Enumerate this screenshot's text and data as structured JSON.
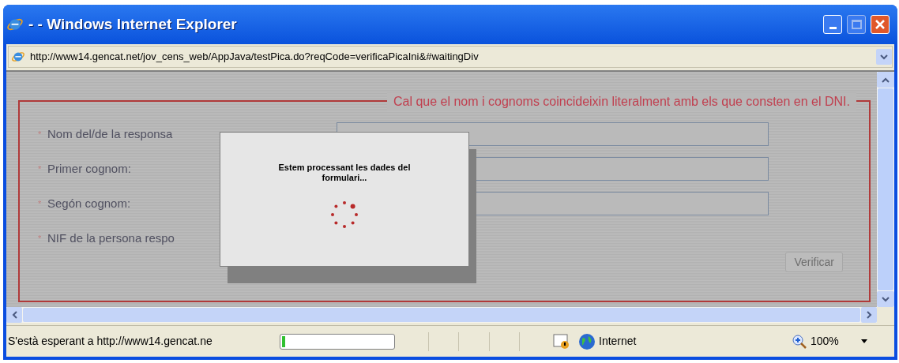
{
  "window": {
    "title": "- - Windows Internet Explorer"
  },
  "address_bar": {
    "url": "http://www14.gencat.net/jov_cens_web/AppJava/testPica.do?reqCode=verificaPicaIni&#waitingDiv"
  },
  "form": {
    "legend": "Cal que el nom i cognoms coincideixin literalment amb els que consten en el DNI.",
    "fields": [
      {
        "marker": "*",
        "label": "Nom del/de la responsa",
        "kind": "text"
      },
      {
        "marker": "*",
        "label": "Primer cognom:",
        "kind": "text"
      },
      {
        "marker": "*",
        "label": "Segón cognom:",
        "kind": "text"
      },
      {
        "marker": "*",
        "label": "NIF de la persona respo",
        "kind": "covered"
      }
    ],
    "verify_button": {
      "label": "Verificar",
      "disabled": true
    }
  },
  "dialog": {
    "message": "Estem processant les dades del formulari..."
  },
  "status_bar": {
    "text": "S'està esperant a http://www14.gencat.ne",
    "progress": {
      "level": 0.03
    },
    "zone": "Internet",
    "zoom": "100%"
  }
}
